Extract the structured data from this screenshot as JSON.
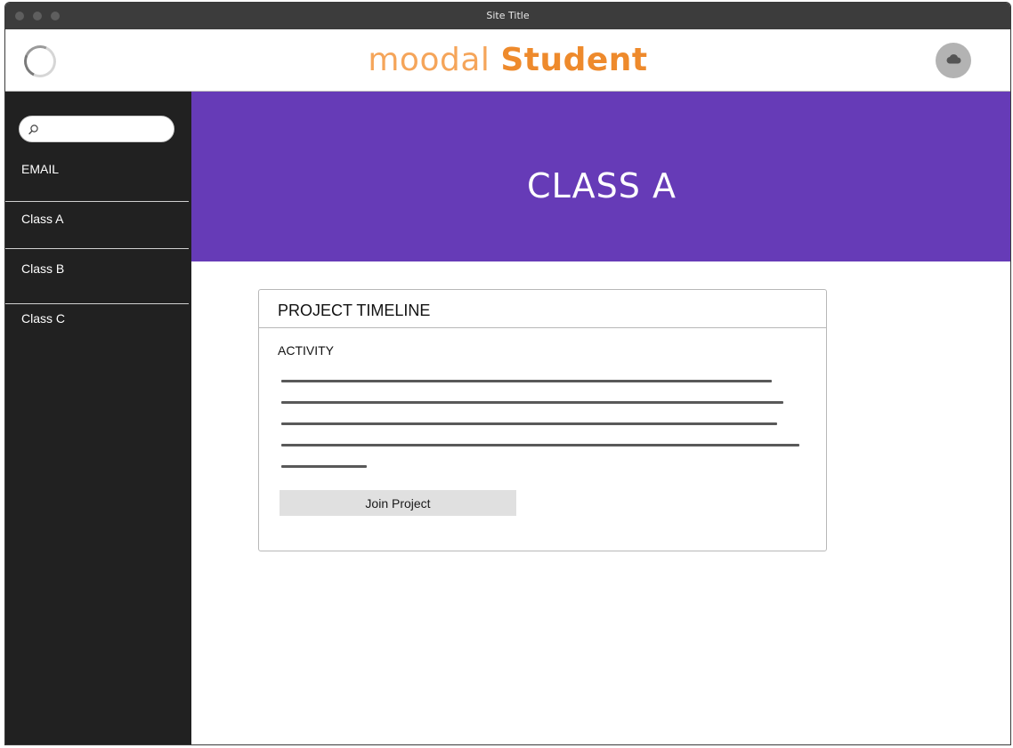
{
  "window": {
    "title": "Site Title"
  },
  "header": {
    "brand_part1": "moodal",
    "brand_part2": "Student",
    "loading_icon": "spinner-icon",
    "profile_icon": "cloud-icon"
  },
  "sidebar": {
    "search": {
      "placeholder": "",
      "value": "",
      "icon": "search-icon"
    },
    "email_label": "EMAIL",
    "items": [
      {
        "label": "Class A"
      },
      {
        "label": "Class B"
      },
      {
        "label": "Class C"
      }
    ]
  },
  "main": {
    "banner_title": "CLASS A",
    "card": {
      "title": "PROJECT TIMELINE",
      "subtitle": "ACTIVITY",
      "button_label": "Join Project"
    }
  },
  "colors": {
    "titlebar": "#3c3c3c",
    "sidebar": "#212121",
    "banner": "#663bb7",
    "brand_light": "#f5a55a",
    "brand_dark": "#ee8a2c",
    "button": "#e0e0e0"
  }
}
